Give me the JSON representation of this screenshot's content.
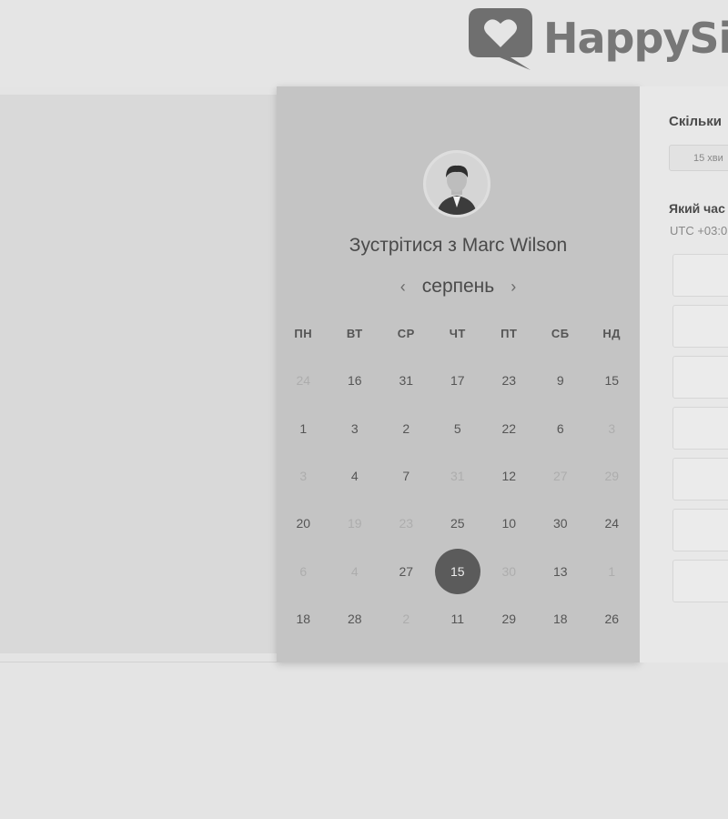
{
  "brand": {
    "name": "HappySig"
  },
  "calendar": {
    "title": "Зустрітися з Marc Wilson",
    "month": "серпень",
    "prev_icon": "‹",
    "next_icon": "›",
    "weekdays": [
      "ПН",
      "ВТ",
      "СР",
      "ЧТ",
      "ПТ",
      "СБ",
      "НД"
    ],
    "days": [
      {
        "label": "24",
        "muted": true
      },
      {
        "label": "16",
        "muted": false
      },
      {
        "label": "31",
        "muted": false
      },
      {
        "label": "17",
        "muted": false
      },
      {
        "label": "23",
        "muted": false
      },
      {
        "label": "9",
        "muted": false
      },
      {
        "label": "15",
        "muted": false
      },
      {
        "label": "1",
        "muted": false
      },
      {
        "label": "3",
        "muted": false
      },
      {
        "label": "2",
        "muted": false
      },
      {
        "label": "5",
        "muted": false
      },
      {
        "label": "22",
        "muted": false
      },
      {
        "label": "6",
        "muted": false
      },
      {
        "label": "3",
        "muted": true
      },
      {
        "label": "3",
        "muted": true
      },
      {
        "label": "4",
        "muted": false
      },
      {
        "label": "7",
        "muted": false
      },
      {
        "label": "31",
        "muted": true
      },
      {
        "label": "12",
        "muted": false
      },
      {
        "label": "27",
        "muted": true
      },
      {
        "label": "29",
        "muted": true
      },
      {
        "label": "20",
        "muted": false
      },
      {
        "label": "19",
        "muted": true
      },
      {
        "label": "23",
        "muted": true
      },
      {
        "label": "25",
        "muted": false
      },
      {
        "label": "10",
        "muted": false
      },
      {
        "label": "30",
        "muted": false
      },
      {
        "label": "24",
        "muted": false
      },
      {
        "label": "6",
        "muted": true
      },
      {
        "label": "4",
        "muted": true
      },
      {
        "label": "27",
        "muted": false
      },
      {
        "label": "15",
        "muted": false,
        "selected": true
      },
      {
        "label": "30",
        "muted": true
      },
      {
        "label": "13",
        "muted": false
      },
      {
        "label": "1",
        "muted": true
      },
      {
        "label": "18",
        "muted": false
      },
      {
        "label": "28",
        "muted": false
      },
      {
        "label": "2",
        "muted": true
      },
      {
        "label": "11",
        "muted": false
      },
      {
        "label": "29",
        "muted": false
      },
      {
        "label": "18",
        "muted": false
      },
      {
        "label": "26",
        "muted": false
      }
    ]
  },
  "booking": {
    "duration_label": "Скільки",
    "duration_value": "15 хви",
    "time_label": "Який час",
    "timezone": "UTC +03:0",
    "slots": [
      "",
      "",
      "",
      "",
      "",
      "",
      ""
    ]
  },
  "colors": {
    "selected_day": "#5b5b5b",
    "card_background": "#c4c4c4",
    "logo": "#777777"
  }
}
